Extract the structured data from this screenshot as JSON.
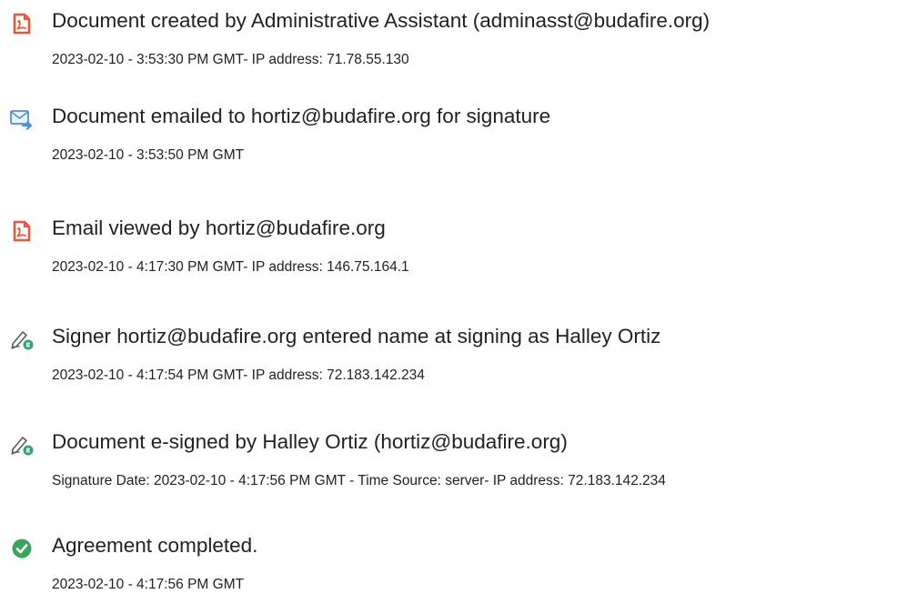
{
  "events": [
    {
      "icon": "document-created-icon",
      "title": "Document created by Administrative Assistant (adminasst@budafire.org)",
      "meta": "2023-02-10 - 3:53:30 PM GMT- IP address: 71.78.55.130"
    },
    {
      "icon": "email-sent-icon",
      "title": "Document emailed to hortiz@budafire.org for signature",
      "meta": "2023-02-10 - 3:53:50 PM GMT"
    },
    {
      "icon": "document-viewed-icon",
      "title": "Email viewed by hortiz@budafire.org",
      "meta": "2023-02-10 - 4:17:30 PM GMT- IP address: 146.75.164.1"
    },
    {
      "icon": "esign-pen-icon",
      "title": "Signer hortiz@budafire.org entered name at signing as Halley Ortiz",
      "meta": "2023-02-10 - 4:17:54 PM GMT- IP address: 72.183.142.234"
    },
    {
      "icon": "esign-pen-icon",
      "title": "Document e-signed by Halley Ortiz (hortiz@budafire.org)",
      "meta": "Signature Date: 2023-02-10 - 4:17:56 PM GMT - Time Source: server- IP address: 72.183.142.234"
    },
    {
      "icon": "check-circle-icon",
      "title": "Agreement completed.",
      "meta": "2023-02-10 - 4:17:56 PM GMT"
    }
  ],
  "colors": {
    "acrobat_red": "#E8573A",
    "email_blue": "#4A90D9",
    "esign_green": "#2FA37A",
    "complete_green": "#3BA55C",
    "text": "#222222"
  }
}
